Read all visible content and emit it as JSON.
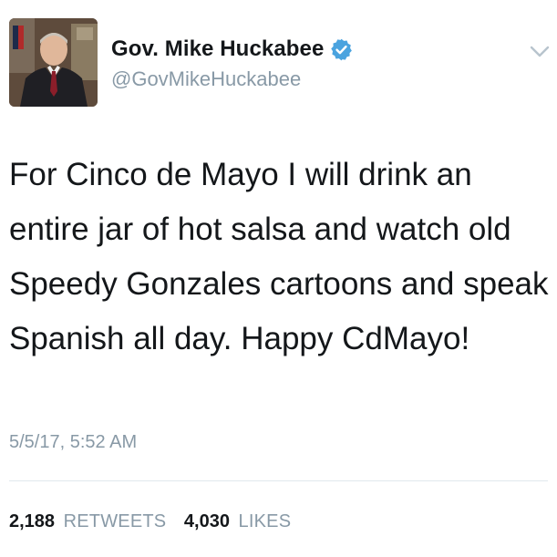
{
  "author": {
    "display_name": "Gov. Mike Huckabee",
    "handle": "@GovMikeHuckabee",
    "avatar_icon": "avatar-photo",
    "verified_icon": "verified-badge-icon",
    "verified_color": "#4aa3df"
  },
  "menu": {
    "icon": "chevron-down-icon"
  },
  "tweet": {
    "text": "For Cinco de Mayo I will drink an entire jar of hot salsa and watch old Speedy Gonzales cartoons and speak Spanish all day. Happy CdMayo!",
    "timestamp": "5/5/17, 5:52 AM"
  },
  "stats": {
    "retweets_count": "2,188",
    "retweets_label": "RETWEETS",
    "likes_count": "4,030",
    "likes_label": "LIKES"
  },
  "colors": {
    "text": "#14171a",
    "secondary_text": "#8899a6",
    "divider": "#e1e8ed",
    "verified": "#4aa3df"
  }
}
